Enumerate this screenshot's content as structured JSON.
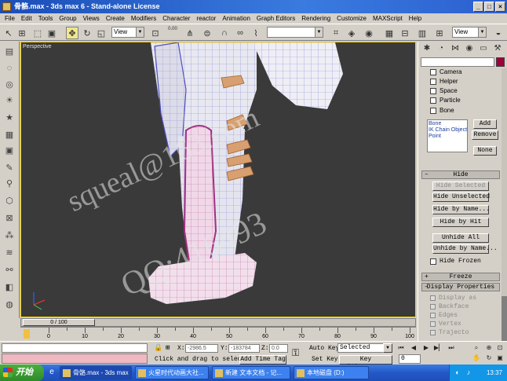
{
  "window": {
    "title": "骨骼.max - 3ds max 6 - Stand-alone License",
    "controls": [
      "_",
      "□",
      "×"
    ]
  },
  "menu": [
    "File",
    "Edit",
    "Tools",
    "Group",
    "Views",
    "Create",
    "Modifiers",
    "Character",
    "reactor",
    "Animation",
    "Graph Editors",
    "Rendering",
    "Customize",
    "MAXScript",
    "Help"
  ],
  "toolbar": {
    "refcoord_dropdown": "View",
    "named_selection_dropdown": "",
    "view_dropdown_right": "View",
    "spinner_label": "0.00"
  },
  "viewport": {
    "label": "Perspective",
    "watermark_1": "squeal@163.com",
    "watermark_2": "QQ:416493"
  },
  "command_panel": {
    "name_field": "",
    "checks": [
      "Camera",
      "Helper",
      "Space",
      "Particle",
      "Bone"
    ],
    "list": [
      "Bone",
      "IK Chain Object",
      "Point"
    ],
    "add": "Add",
    "remove": "Remove",
    "none": "None",
    "hide_rollout": "Hide",
    "hide_selected": "Hide Selected",
    "hide_unselected": "Hide Unselected",
    "hide_by_name": "Hide by Name...",
    "hide_by_hit": "Hide by Hit",
    "unhide_all": "Unhide All",
    "unhide_by_name": "Unhide by Name...",
    "hide_frozen": "Hide Frozen",
    "freeze_rollout": "Freeze",
    "display_props_rollout": "Display Properties",
    "display_props": [
      "Display as",
      "Backface",
      "Edges",
      "Vertex",
      "Trajecto"
    ]
  },
  "timeline": {
    "slider_label": "0 / 100",
    "ticks": [
      0,
      10,
      20,
      30,
      40,
      50,
      60,
      70,
      80,
      90,
      100
    ]
  },
  "status": {
    "prompt": "Click and drag to select",
    "add_time_tag": "Add Time Tag",
    "x_label": "X:",
    "x_value": "-2986.5",
    "y_label": "Y:",
    "y_value": "-183784",
    "z_label": "Z:",
    "z_value": "0.0",
    "auto_key": "Auto Key",
    "set_key": "Set Key",
    "selected": "Selected",
    "key_filters": "Key Filters...",
    "frame": "0"
  },
  "taskbar": {
    "start": "开始",
    "tasks": [
      "骨骼.max - 3ds max",
      "火星时代动画大社...",
      "新建 文本文档 - 记...",
      "本地磁盘 (D:)"
    ],
    "clock": "13:37"
  },
  "colors": {
    "titlebar": "#2b5fcf",
    "viewport_bg": "#3a3a3a",
    "active_border": "#f5d000",
    "object_color": "#a0003a"
  }
}
